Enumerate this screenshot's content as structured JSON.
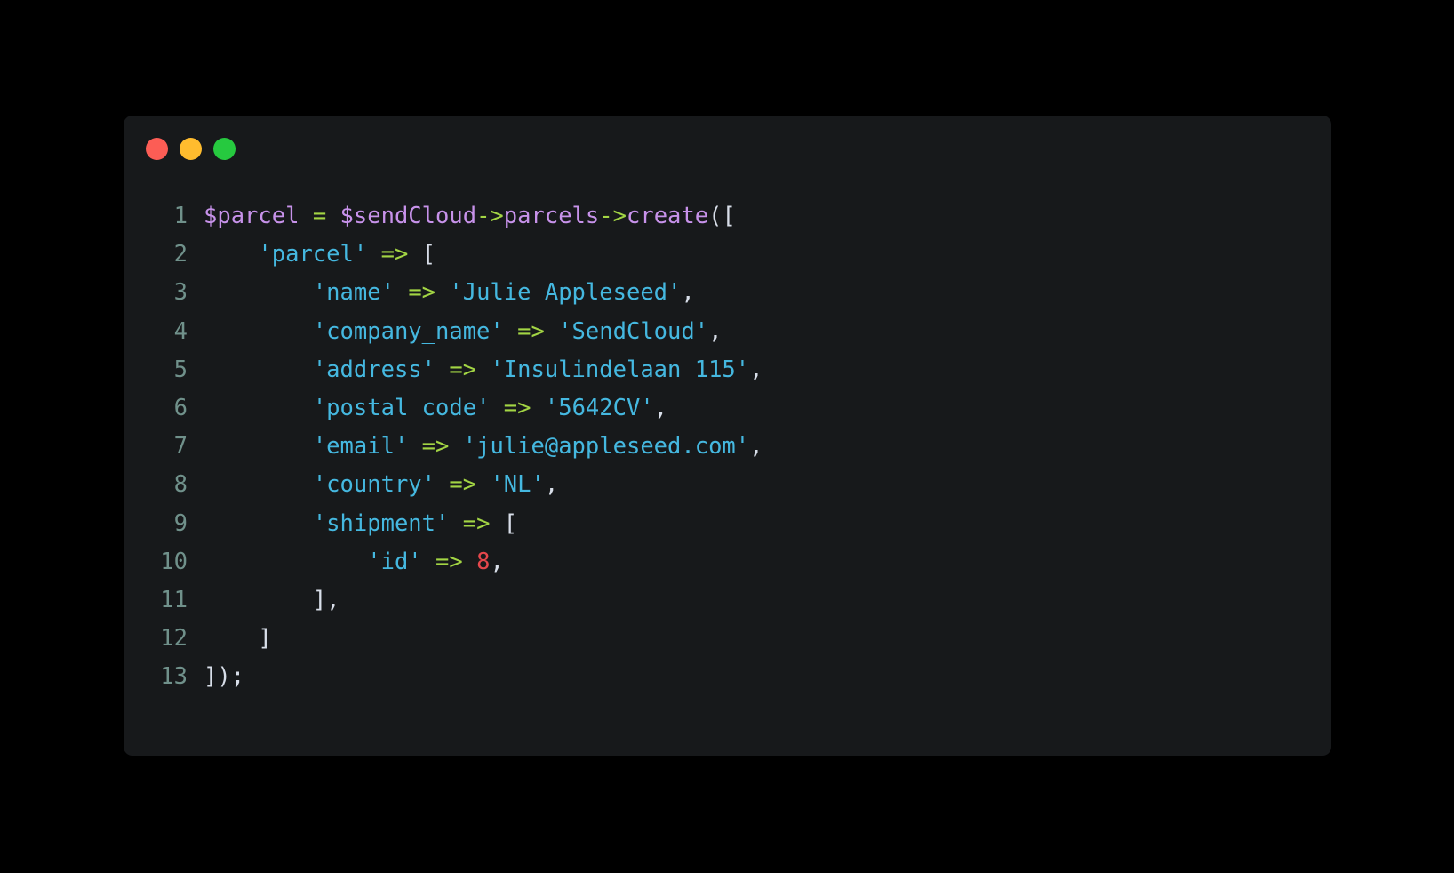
{
  "window": {
    "background_color": "#17191b",
    "page_background_color": "#000000",
    "traffic_lights": [
      {
        "name": "close",
        "color": "#fc5d55"
      },
      {
        "name": "minimize",
        "color": "#ffbc2e"
      },
      {
        "name": "maximize",
        "color": "#26c93f"
      }
    ]
  },
  "theme": {
    "line_number_color": "#70918b",
    "variable_color": "#c792ea",
    "operator_color": "#a3d544",
    "string_color": "#45b8e0",
    "number_color": "#e5474c",
    "punctuation_color": "#d8dee9"
  },
  "code": {
    "language": "php",
    "line_numbers": [
      "1",
      "2",
      "3",
      "4",
      "5",
      "6",
      "7",
      "8",
      "9",
      "10",
      "11",
      "12",
      "13"
    ],
    "lines": [
      {
        "number": "1",
        "text": "$parcel = $sendCloud->parcels->create(["
      },
      {
        "number": "2",
        "text": "    'parcel' => ["
      },
      {
        "number": "3",
        "text": "        'name' => 'Julie Appleseed',"
      },
      {
        "number": "4",
        "text": "        'company_name' => 'SendCloud',"
      },
      {
        "number": "5",
        "text": "        'address' => 'Insulindelaan 115',"
      },
      {
        "number": "6",
        "text": "        'postal_code' => '5642CV',"
      },
      {
        "number": "7",
        "text": "        'email' => 'julie@appleseed.com',"
      },
      {
        "number": "8",
        "text": "        'country' => 'NL',"
      },
      {
        "number": "9",
        "text": "        'shipment' => ["
      },
      {
        "number": "10",
        "text": "            'id' => 8,"
      },
      {
        "number": "11",
        "text": "        ],"
      },
      {
        "number": "12",
        "text": "    ]"
      },
      {
        "number": "13",
        "text": "]);"
      }
    ],
    "tokens": [
      [
        {
          "t": "$parcel",
          "c": "var"
        },
        {
          "t": " ",
          "c": "plain"
        },
        {
          "t": "=",
          "c": "op"
        },
        {
          "t": " ",
          "c": "plain"
        },
        {
          "t": "$sendCloud",
          "c": "var"
        },
        {
          "t": "->",
          "c": "arrow"
        },
        {
          "t": "parcels",
          "c": "method"
        },
        {
          "t": "->",
          "c": "arrow"
        },
        {
          "t": "create",
          "c": "method"
        },
        {
          "t": "([",
          "c": "punct"
        }
      ],
      [
        {
          "t": "    ",
          "c": "plain"
        },
        {
          "t": "'parcel'",
          "c": "string"
        },
        {
          "t": " ",
          "c": "plain"
        },
        {
          "t": "=>",
          "c": "arrow"
        },
        {
          "t": " ",
          "c": "plain"
        },
        {
          "t": "[",
          "c": "punct"
        }
      ],
      [
        {
          "t": "        ",
          "c": "plain"
        },
        {
          "t": "'name'",
          "c": "string"
        },
        {
          "t": " ",
          "c": "plain"
        },
        {
          "t": "=>",
          "c": "arrow"
        },
        {
          "t": " ",
          "c": "plain"
        },
        {
          "t": "'Julie Appleseed'",
          "c": "string"
        },
        {
          "t": ",",
          "c": "punct"
        }
      ],
      [
        {
          "t": "        ",
          "c": "plain"
        },
        {
          "t": "'company_name'",
          "c": "string"
        },
        {
          "t": " ",
          "c": "plain"
        },
        {
          "t": "=>",
          "c": "arrow"
        },
        {
          "t": " ",
          "c": "plain"
        },
        {
          "t": "'SendCloud'",
          "c": "string"
        },
        {
          "t": ",",
          "c": "punct"
        }
      ],
      [
        {
          "t": "        ",
          "c": "plain"
        },
        {
          "t": "'address'",
          "c": "string"
        },
        {
          "t": " ",
          "c": "plain"
        },
        {
          "t": "=>",
          "c": "arrow"
        },
        {
          "t": " ",
          "c": "plain"
        },
        {
          "t": "'Insulindelaan 115'",
          "c": "string"
        },
        {
          "t": ",",
          "c": "punct"
        }
      ],
      [
        {
          "t": "        ",
          "c": "plain"
        },
        {
          "t": "'postal_code'",
          "c": "string"
        },
        {
          "t": " ",
          "c": "plain"
        },
        {
          "t": "=>",
          "c": "arrow"
        },
        {
          "t": " ",
          "c": "plain"
        },
        {
          "t": "'5642CV'",
          "c": "string"
        },
        {
          "t": ",",
          "c": "punct"
        }
      ],
      [
        {
          "t": "        ",
          "c": "plain"
        },
        {
          "t": "'email'",
          "c": "string"
        },
        {
          "t": " ",
          "c": "plain"
        },
        {
          "t": "=>",
          "c": "arrow"
        },
        {
          "t": " ",
          "c": "plain"
        },
        {
          "t": "'julie@appleseed.com'",
          "c": "string"
        },
        {
          "t": ",",
          "c": "punct"
        }
      ],
      [
        {
          "t": "        ",
          "c": "plain"
        },
        {
          "t": "'country'",
          "c": "string"
        },
        {
          "t": " ",
          "c": "plain"
        },
        {
          "t": "=>",
          "c": "arrow"
        },
        {
          "t": " ",
          "c": "plain"
        },
        {
          "t": "'NL'",
          "c": "string"
        },
        {
          "t": ",",
          "c": "punct"
        }
      ],
      [
        {
          "t": "        ",
          "c": "plain"
        },
        {
          "t": "'shipment'",
          "c": "string"
        },
        {
          "t": " ",
          "c": "plain"
        },
        {
          "t": "=>",
          "c": "arrow"
        },
        {
          "t": " ",
          "c": "plain"
        },
        {
          "t": "[",
          "c": "punct"
        }
      ],
      [
        {
          "t": "            ",
          "c": "plain"
        },
        {
          "t": "'id'",
          "c": "string"
        },
        {
          "t": " ",
          "c": "plain"
        },
        {
          "t": "=>",
          "c": "arrow"
        },
        {
          "t": " ",
          "c": "plain"
        },
        {
          "t": "8",
          "c": "number"
        },
        {
          "t": ",",
          "c": "punct"
        }
      ],
      [
        {
          "t": "        ",
          "c": "plain"
        },
        {
          "t": "],",
          "c": "punct"
        }
      ],
      [
        {
          "t": "    ",
          "c": "plain"
        },
        {
          "t": "]",
          "c": "punct"
        }
      ],
      [
        {
          "t": "]);",
          "c": "punct"
        }
      ]
    ]
  }
}
